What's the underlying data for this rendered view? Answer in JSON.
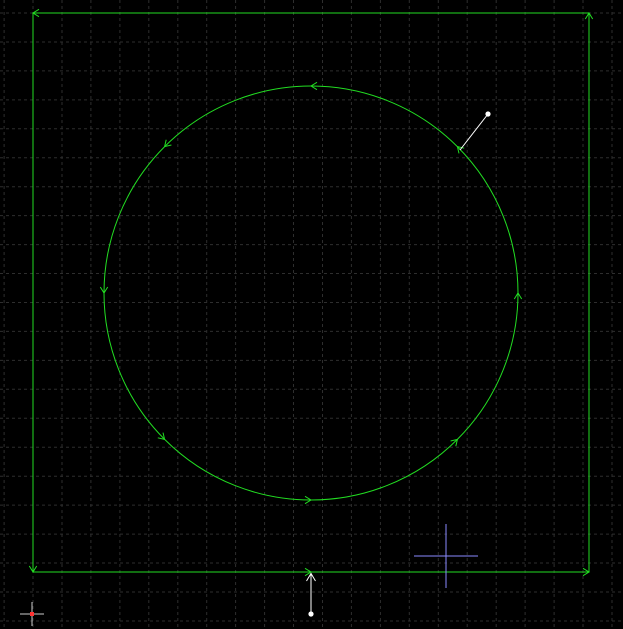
{
  "canvas": {
    "background": "#000000",
    "grid_visible": true,
    "grid_color": "#2e2e2e"
  },
  "toolpaths": {
    "color": "#22dd22",
    "outer_contour": {
      "shape": "rectangle",
      "direction": "counter-clockwise"
    },
    "inner_contour": {
      "shape": "circle",
      "direction": "counter-clockwise"
    }
  },
  "lead_ins": {
    "color": "#ffffff",
    "count": 2
  },
  "cursor": {
    "color": "#8a8aff",
    "icon": "crosshair-cursor-icon"
  },
  "origin": {
    "color_h": "#cccccc",
    "color_v": "#ff3333",
    "icon": "origin-marker-icon"
  }
}
